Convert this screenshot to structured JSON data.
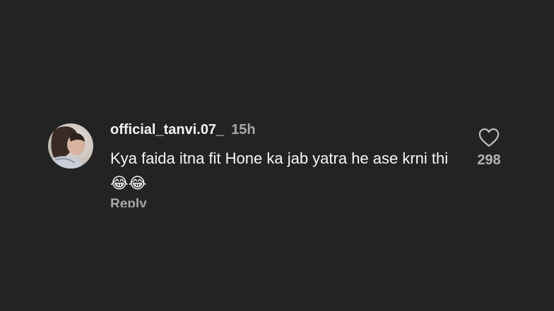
{
  "comment": {
    "username": "official_tanvi.07_",
    "time": "15h",
    "text": "Kya faida itna fit Hone ka jab yatra he ase krni thi",
    "emojis": "😂😂",
    "reply_label": "Reply",
    "like_count": "298"
  },
  "icons": {
    "like": "heart-outline-icon",
    "avatar": "profile-photo"
  },
  "colors": {
    "background": "#232323",
    "primary_text": "#f5f5f5",
    "secondary_text": "#a8a8a8"
  }
}
